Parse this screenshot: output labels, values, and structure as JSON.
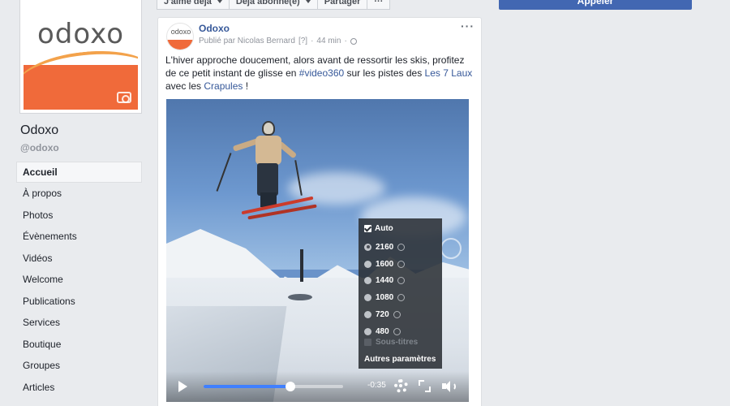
{
  "page": {
    "name": "Odoxo",
    "handle": "@odoxo",
    "logo_text": "odoxo"
  },
  "sidebar": {
    "items": [
      {
        "label": "Accueil",
        "active": true
      },
      {
        "label": "À propos"
      },
      {
        "label": "Photos"
      },
      {
        "label": "Évènements"
      },
      {
        "label": "Vidéos"
      },
      {
        "label": "Welcome"
      },
      {
        "label": "Publications"
      },
      {
        "label": "Services"
      },
      {
        "label": "Boutique"
      },
      {
        "label": "Groupes"
      },
      {
        "label": "Articles"
      }
    ]
  },
  "action_bar": {
    "like_label": "J'aime déjà",
    "follow_label": "Déjà abonné(e)",
    "share_label": "Partager",
    "more_label": "···",
    "call_label": "Appeler"
  },
  "post": {
    "author": "Odoxo",
    "avatar_text": "odoxo",
    "published_by": "Publié par Nicolas Bernard",
    "info_mark": "[?]",
    "time": "44 min",
    "menu_label": "···",
    "text_part1": "L'hiver approche doucement, alors avant de ressortir les skis, profitez de ce petit instant de glisse en ",
    "hashtag": "#video360",
    "text_part2": " sur les pistes des ",
    "link_place": "Les 7 Laux",
    "text_part3": " avec les ",
    "link_crew": "Crapules",
    "text_part4": " !"
  },
  "video": {
    "time_remaining": "-0:35",
    "progress": 0.62,
    "quality_menu": {
      "auto_label": "Auto",
      "auto_checked": true,
      "options": [
        {
          "label": "2160",
          "selected": true
        },
        {
          "label": "1600",
          "selected": false
        },
        {
          "label": "1440",
          "selected": false
        },
        {
          "label": "1080",
          "selected": false
        },
        {
          "label": "720",
          "selected": false
        },
        {
          "label": "480",
          "selected": false
        }
      ],
      "subtitles_label": "Sous-titres",
      "more_settings_label": "Autres paramètres"
    }
  },
  "colors": {
    "brand_orange": "#f06a3a",
    "link_blue": "#365899",
    "button_blue": "#4267b2",
    "progress_blue": "#4080ff"
  }
}
